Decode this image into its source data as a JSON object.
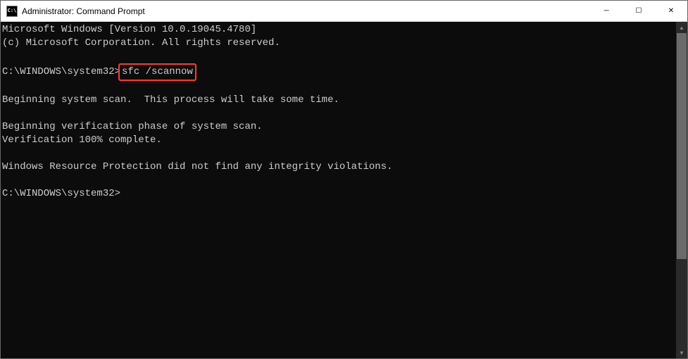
{
  "titlebar": {
    "icon_label": "C:\\",
    "title": "Administrator: Command Prompt"
  },
  "window_controls": {
    "minimize": "─",
    "maximize": "☐",
    "close": "✕"
  },
  "terminal": {
    "header_line1": "Microsoft Windows [Version 10.0.19045.4780]",
    "header_line2": "(c) Microsoft Corporation. All rights reserved.",
    "prompt1_path": "C:\\WINDOWS\\system32>",
    "prompt1_command": "sfc /scannow",
    "output_line1": "Beginning system scan.  This process will take some time.",
    "output_line2": "Beginning verification phase of system scan.",
    "output_line3": "Verification 100% complete.",
    "output_line4": "Windows Resource Protection did not find any integrity violations.",
    "prompt2_path": "C:\\WINDOWS\\system32>",
    "prompt2_command": ""
  },
  "scrollbar": {
    "up_arrow": "▲",
    "down_arrow": "▼"
  }
}
